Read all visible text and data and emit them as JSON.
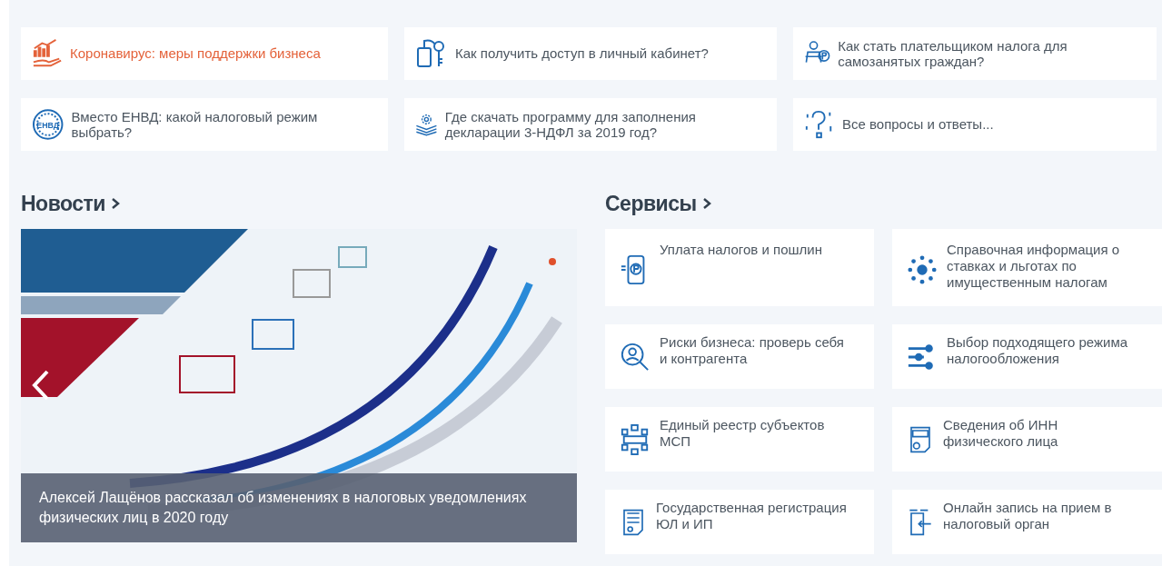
{
  "quick_links": [
    {
      "text": "Коронавирус: меры поддержки бизнеса",
      "kind": "highlight"
    },
    {
      "text": "Как получить доступ в личный кабинет?",
      "kind": "normal"
    },
    {
      "text": "Как стать плательщиком налога для самозанятых граждан?",
      "kind": "normal"
    },
    {
      "text": "Вместо ЕНВД: какой налоговый режим выбрать?",
      "kind": "normal",
      "icon_label": "ЕНВД"
    },
    {
      "text": "Где скачать программу для заполнения декларации 3-НДФЛ за 2019 год?",
      "kind": "normal"
    },
    {
      "text": "Все вопросы и ответы...",
      "kind": "normal"
    }
  ],
  "news": {
    "heading": "Новости",
    "caption": "Алексей Лащёнов рассказал об изменениях в налоговых уведомлениях физических лиц в 2020 году"
  },
  "services": {
    "heading": "Сервисы",
    "items": [
      {
        "text": "Уплата налогов и пошлин"
      },
      {
        "text": "Справочная информация о ставках и льготах по имущественным налогам"
      },
      {
        "text": "Риски бизнеса: проверь себя и контрагента"
      },
      {
        "text": "Выбор подходящего режима налогообложения"
      },
      {
        "text": "Единый реестр субъектов МСП"
      },
      {
        "text": "Сведения об ИНН физического лица"
      },
      {
        "text": "Государственная регистрация ЮЛ и ИП"
      },
      {
        "text": "Онлайн запись на прием в налоговый орган"
      }
    ]
  }
}
